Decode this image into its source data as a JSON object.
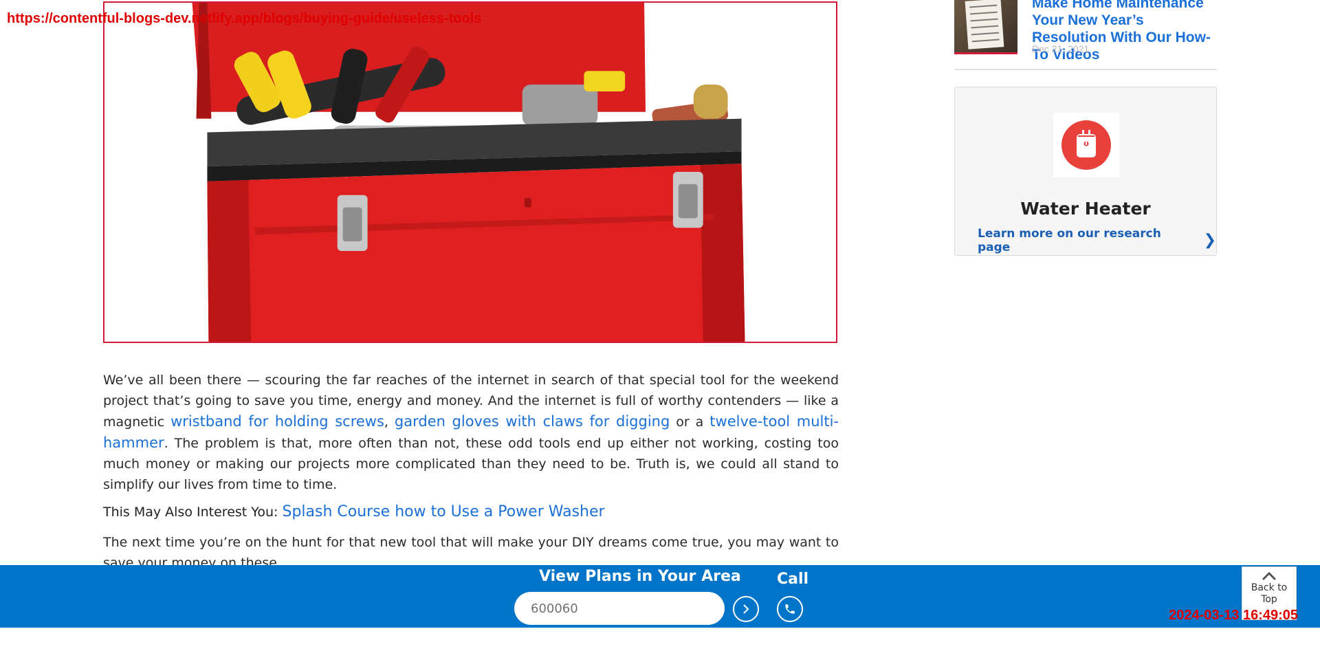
{
  "overlay": {
    "url": "https://contentful-blogs-dev.netlify.app/blogs/buying-guide/useless-tools",
    "timestamp": "2024-03-13 16:49:05"
  },
  "hero": {
    "alt_icon": "toolbox-image"
  },
  "article": {
    "p1_a": "We’ve all been there — scouring the far reaches of the internet in search of that special tool for the weekend project that’s going to save you time, energy and money. And the internet is full of worthy contenders — like a magnetic ",
    "link1": "wristband for holding screws",
    "sep1": ", ",
    "link2": "garden gloves with claws for digging",
    "sep2": " or a ",
    "link3": "twelve-tool multi-hammer",
    "p1_b": ". The problem is that, more often than not, these odd tools end up either not working, costing too much money or making our projects more complicated than they need to be. Truth is, we could all stand to simplify our lives from time to time.",
    "interest_label": "This May Also Interest You:",
    "interest_link": "Splash Course how to Use a Power Washer",
    "p2": "The next time you’re on the hunt for that new tool that will make your DIY dreams come true, you may want to save your money on these."
  },
  "sidebar": {
    "card": {
      "title": "Make Home Maintenance Your New Year’s Resolution With Our How-To Videos",
      "date": "Dec 21, 2021"
    },
    "research": {
      "title": "Water Heater",
      "link": "Learn more on our research page",
      "icon": "water-heater-icon",
      "accent": "#e8403a"
    }
  },
  "bottom_bar": {
    "title": "View Plans in Your Area",
    "zip_value": "600060",
    "call_label": "Call",
    "back_to_top": "Back to Top",
    "color": "#0074c8"
  }
}
